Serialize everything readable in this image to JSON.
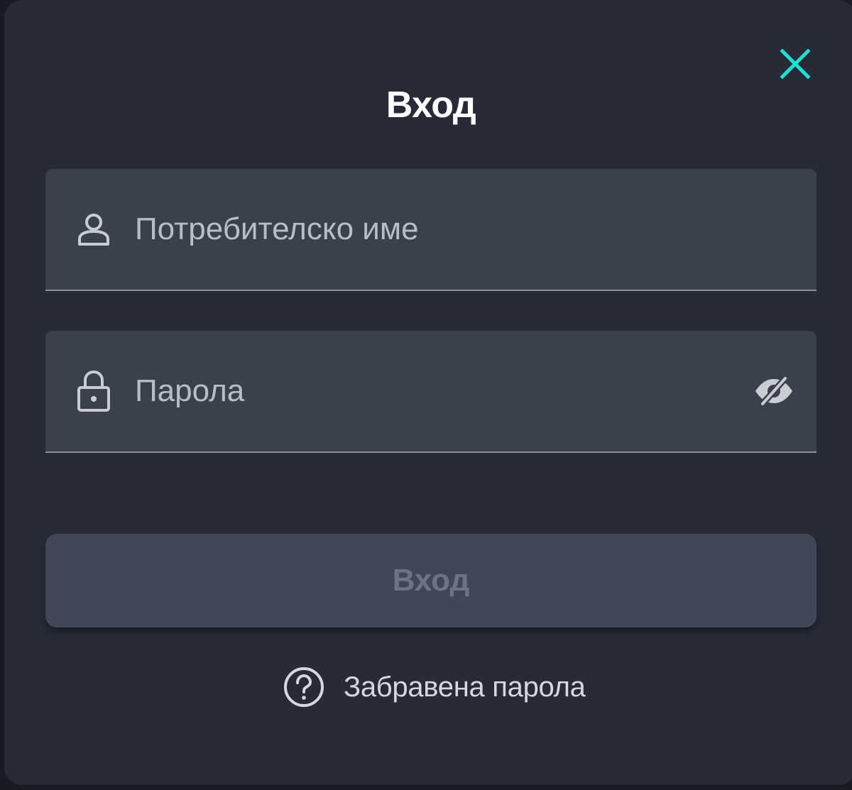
{
  "dialog": {
    "title": "Вход",
    "close_icon": "close-icon",
    "accent_color": "#1fe0d2"
  },
  "form": {
    "username": {
      "icon": "user-icon",
      "placeholder": "Потребителско име",
      "value": ""
    },
    "password": {
      "icon": "lock-icon",
      "placeholder": "Парола",
      "value": "",
      "visibility_icon": "eye-off-icon"
    },
    "submit_label": "Вход",
    "submit_enabled": false
  },
  "forgot_password": {
    "icon": "help-circle-icon",
    "label": "Забравена парола"
  }
}
